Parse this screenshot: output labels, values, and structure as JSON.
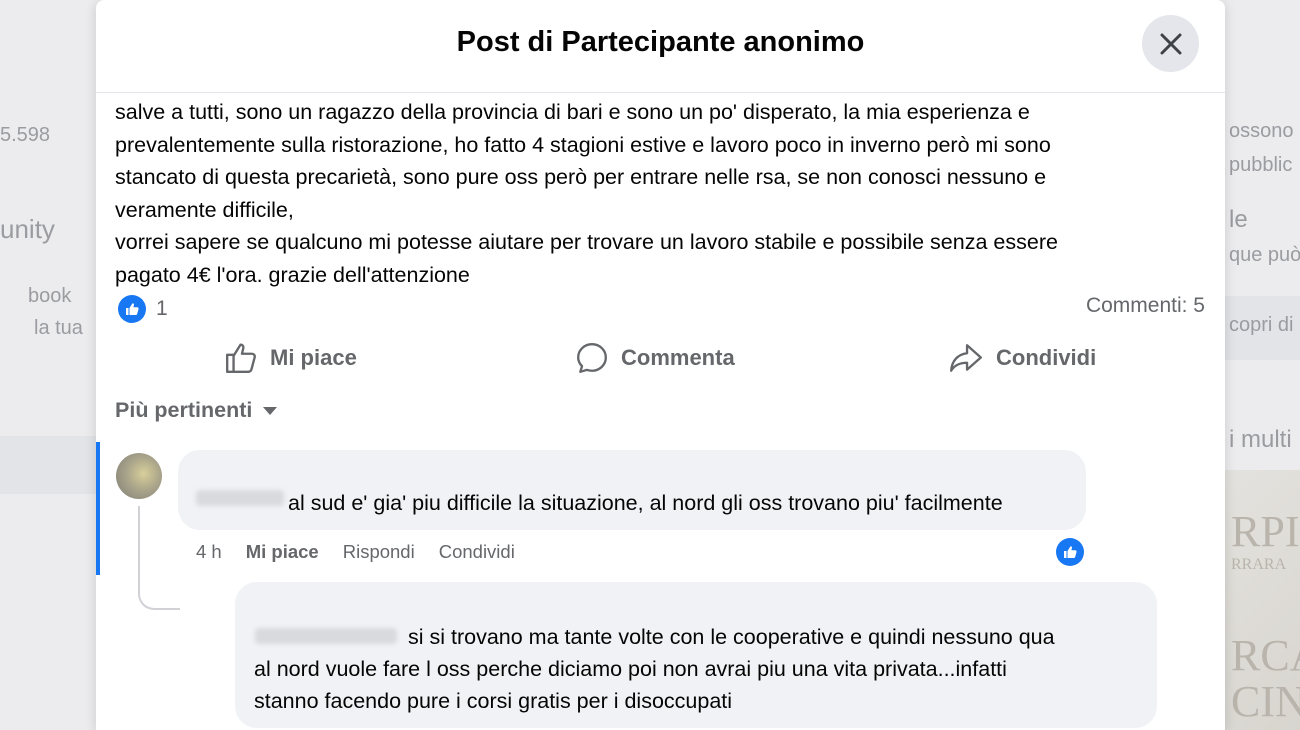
{
  "background": {
    "left_texts": [
      "5.598",
      "unity",
      "book",
      "la tua"
    ],
    "right_texts": [
      "ossono",
      "pubblic",
      "le",
      "que può",
      "copri di",
      "i multi",
      "RPIS",
      "RRARA",
      "RCA",
      "CIN"
    ]
  },
  "modal": {
    "title": "Post di Partecipante anonimo",
    "close_icon": "close-icon"
  },
  "post": {
    "lines": [
      "salve a tutti, sono un ragazzo della provincia di bari e sono un po' disperato, la mia esperienza e",
      "prevalentemente sulla ristorazione, ho fatto 4 stagioni estive e lavoro poco in inverno però mi sono",
      "stancato di questa precarietà, sono pure oss però per entrare nelle rsa, se non conosci nessuno e",
      "veramente difficile,",
      "vorrei sapere se qualcuno mi potesse aiutare per trovare un lavoro stabile e possibile senza essere",
      "pagato 4€ l'ora. grazie dell'attenzione"
    ],
    "reaction_count": "1",
    "comments_count": "Commenti: 5"
  },
  "actions": {
    "like": "Mi piace",
    "comment": "Commenta",
    "share": "Condividi"
  },
  "sort": {
    "label": "Più pertinenti"
  },
  "comments": [
    {
      "text": "al sud e' gia' piu difficile la situazione, al nord gli oss trovano piu' facilmente",
      "time": "4 h",
      "like": "Mi piace",
      "reply": "Rispondi",
      "share": "Condividi"
    },
    {
      "lines": [
        "si si trovano ma tante volte con le cooperative e quindi nessuno qua",
        "al nord vuole fare l oss perche diciamo poi non avrai piu una vita privata...infatti",
        "stanno facendo pure i corsi gratis per i disoccupati"
      ]
    }
  ],
  "colors": {
    "accent": "#1877f2",
    "text": "#050505",
    "secondary_text": "#65676b",
    "bubble": "#f0f2f5"
  }
}
